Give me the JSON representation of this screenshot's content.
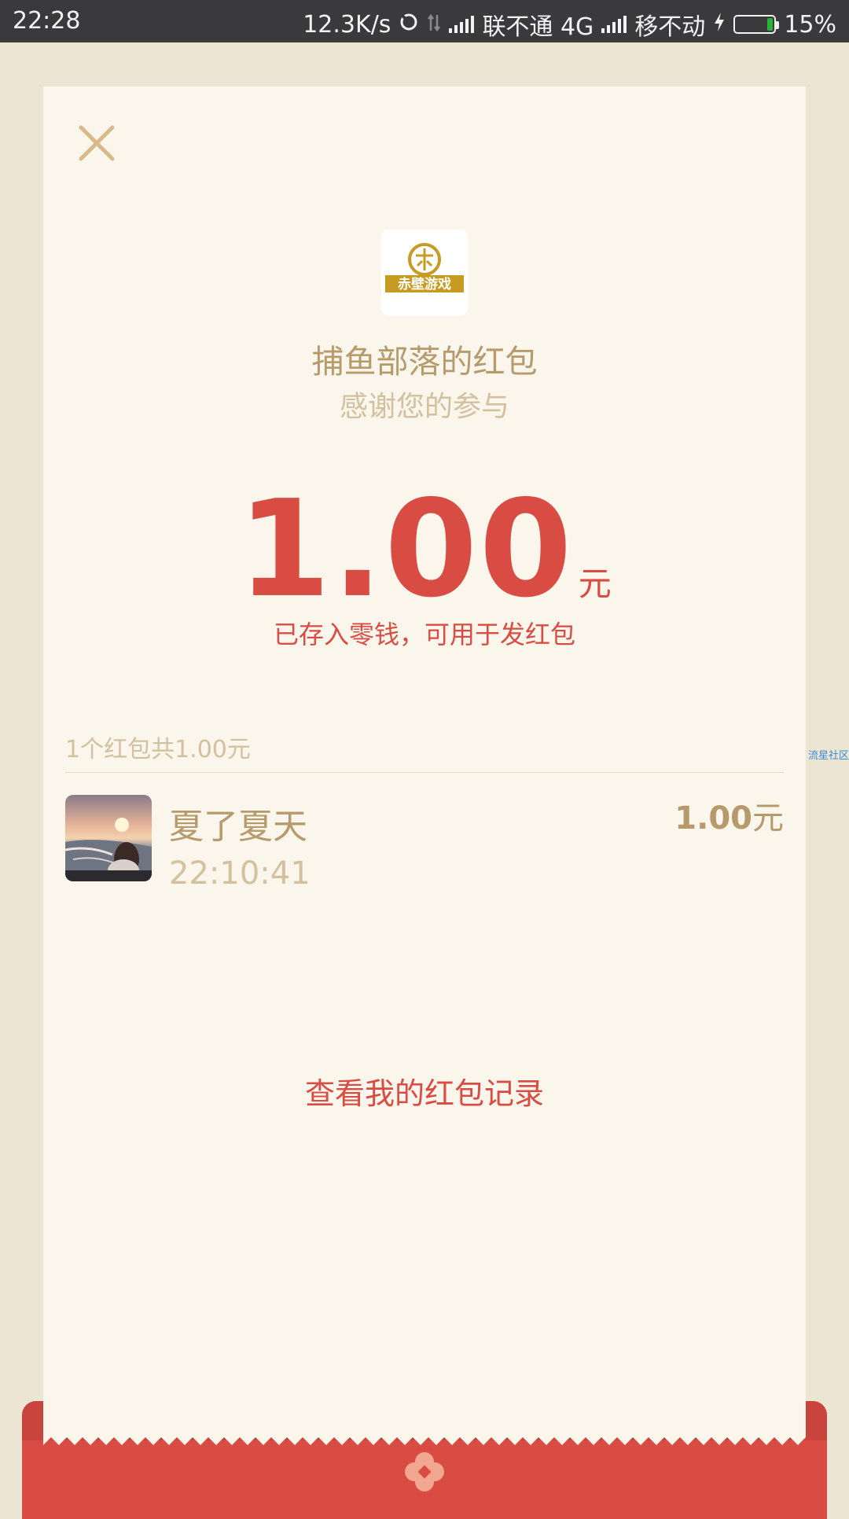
{
  "status_bar": {
    "time": "22:28",
    "speed": "12.3K/s",
    "carrier1": "联不通 4G",
    "carrier2": "移不动",
    "battery_text": "15%",
    "battery_level": 0.15,
    "battery_color": "#27b33a"
  },
  "packet": {
    "logo_text": "赤壁游戏",
    "title": "捕鱼部落的红包",
    "subtitle": "感谢您的参与",
    "amount": "1.00",
    "amount_unit": "元",
    "note": "已存入零钱，可用于发红包",
    "summary": "1个红包共1.00元"
  },
  "receivers": [
    {
      "name": "夏了夏天",
      "time": "22:10:41",
      "amount": "1.00",
      "unit": "元"
    }
  ],
  "links": {
    "records": "查看我的红包记录"
  },
  "watermark": "流星社区",
  "colors": {
    "accent_red": "#d94c43",
    "gold": "#b69a6c",
    "light_gold": "#d3c09e",
    "card_bg": "#faf6ec",
    "page_bg": "#ede5d3"
  }
}
